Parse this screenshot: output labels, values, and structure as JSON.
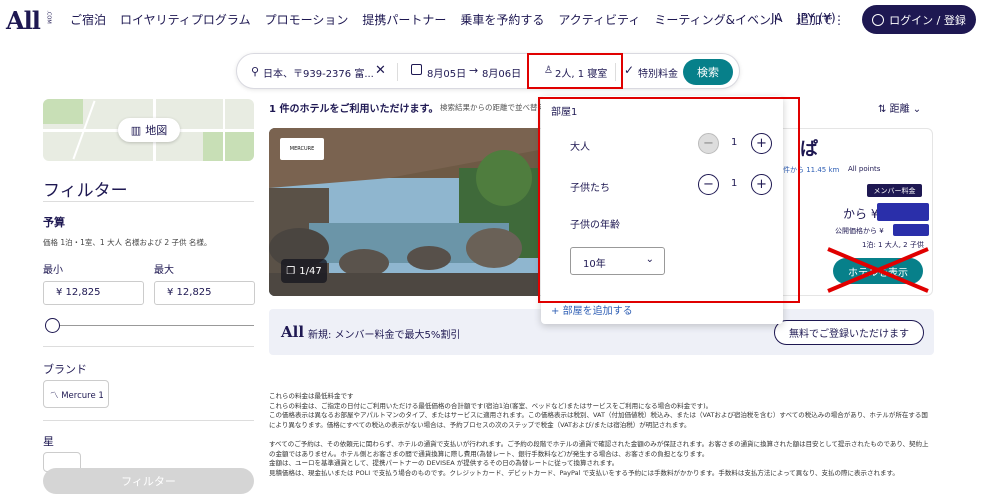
{
  "header": {
    "logo": "All",
    "logo_suffix": ".COM",
    "nav": [
      "ご宿泊",
      "ロイヤリティプログラム",
      "プロモーション",
      "提携パートナー",
      "乗車を予約する",
      "アクティビティ",
      "ミーティング&イベント",
      "追加で⋮"
    ],
    "language": "JA",
    "currency": "JPY (¥)",
    "login": "ログイン / 登録"
  },
  "search": {
    "location": "日本、〒939-2376 富...",
    "checkin": "8月05日",
    "checkout": "8月06日",
    "guests": "2人, 1 寝室",
    "rate": "特別料金",
    "submit": "検索"
  },
  "sidebar": {
    "map_button": "地図",
    "filter_title": "フィルター",
    "budget_label": "予算",
    "budget_sub": "価格 1泊・1室、1 大人 名様および 2 子供 名様。",
    "min_label": "最小",
    "max_label": "最大",
    "min_value": "¥ 12,825",
    "max_value": "¥ 12,825",
    "brand_label": "ブランド",
    "brand_chip": "Mercure 1",
    "star_label": "星",
    "filter_button": "フィルター"
  },
  "results": {
    "count": "1 件のホテルをご利用いただけます。",
    "note": "検索結果からの距離で並べ替え",
    "sort": "距離",
    "hotel_title_fragment": "ぱ",
    "distance": "件から 11.45 km",
    "all_points": "All points",
    "member_tag": "メンバー料金",
    "from": "から ¥",
    "public_price": "公開価格から ¥",
    "occupancy": "1泊: 1 大人, 2 子供",
    "view_button": "ホテルを表示",
    "photo_badge": "MERCURE",
    "photo_count": "1/47"
  },
  "promo": {
    "logo": "All",
    "text": "新規: メンバー料金で最大5%割引",
    "register": "無料でご登録いただけます"
  },
  "legal": {
    "p1": "これらの料金は最低料金です",
    "p2": "これらの料金は、ご指定の日付にご利用いただける最低価格の合計額です(宿泊1泊(客室、ベッドなど)またはサービスをご利用になる場合の料金です)。",
    "p3": "この価格表示は異なるお部屋やアパルトマンのタイプ、またはサービスに適用されます。この価格表示は税別、VAT（付加価値税）税込み、または（VATおよび宿泊税を含む）すべての税込みの場合があり、ホテルが所在する国により異なります。価格にすべての税込の表示がない場合は、予約プロセスの次のステップで税金（VATおよび/または宿泊税）が明記されます。",
    "p4": "すべてのご予約は、その依頼元に関わらず、ホテルの通貨で支払いが行われます。ご予約の段階でホテルの通貨で確認された金額のみが保証されます。お客さまの通貨に換算された額は目安として提示されたものであり、契約上の金額ではありません。ホテル側とお客さまの間で通貨換算に際し費用(為替レート、銀行手数料など)が発生する場合は、お客さまの負担となります。",
    "p5": "金額は、ユーロを基準通貨として、提携パートナーの DEVISEA が提供するその日の為替レートに従って換算されます。",
    "p6": "見積価格は、現金払いまたは POLI で支払う場合のものです。クレジットカード、デビットカード、PayPal で支払いをする予約には手数料がかかります。手数料は支払方法によって異なり、支払の際に表示されます。"
  },
  "guest_dropdown": {
    "room_title": "部屋1",
    "adults_label": "大人",
    "adults_value": "1",
    "children_label": "子供たち",
    "children_value": "1",
    "child_age_label": "子供の年齢",
    "child_age_value": "10年",
    "add_room": "部屋を追加する"
  },
  "colors": {
    "brand_navy": "#1e1852",
    "accent_teal": "#07808a",
    "annotation_red": "#e00000"
  }
}
